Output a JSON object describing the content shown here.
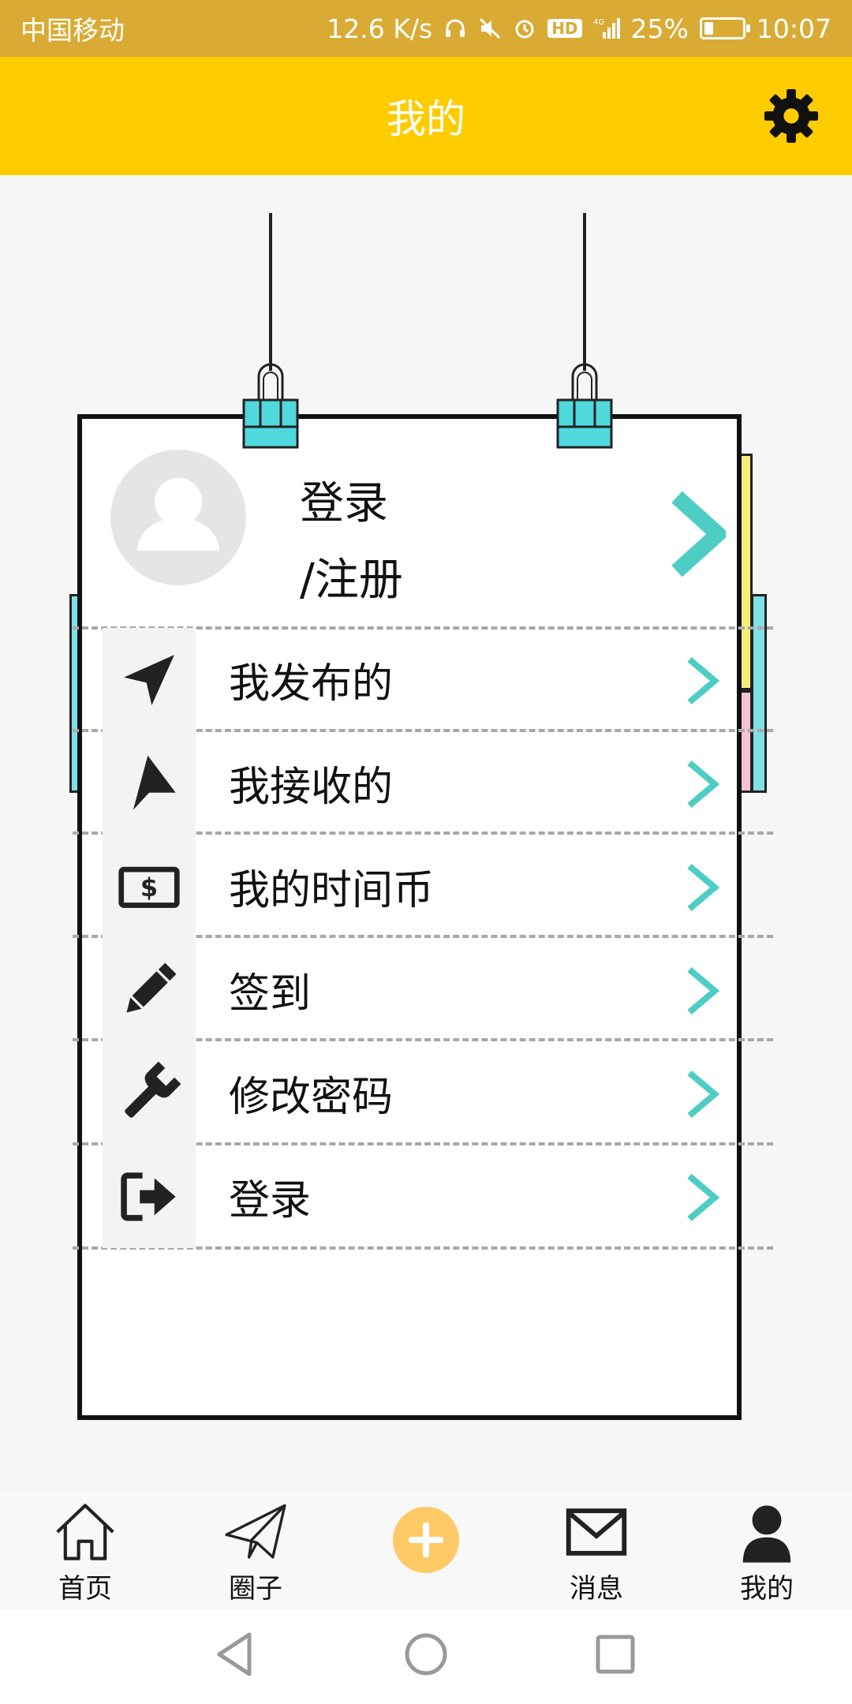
{
  "status_bar": {
    "carrier": "中国移动",
    "speed": "12.6 K/s",
    "hd_badge": "HD",
    "network": "4G",
    "battery_percent": "25%",
    "battery_level": 0.25,
    "time": "10:07",
    "icons": [
      "headphones-icon",
      "mute-icon",
      "alarm-icon",
      "hd-icon",
      "signal-icon",
      "battery-icon"
    ]
  },
  "app_bar": {
    "title": "我的",
    "settings_icon": "gear-icon"
  },
  "profile": {
    "login_line1": "登录",
    "login_line2": "/注册",
    "avatar_icon": "avatar-icon",
    "chevron_icon": "chevron-right-icon"
  },
  "menu": {
    "items": [
      {
        "label": "我发布的",
        "icon": "navigation-arrow-icon"
      },
      {
        "label": "我接收的",
        "icon": "receive-arrow-icon"
      },
      {
        "label": "我的时间币",
        "icon": "money-icon"
      },
      {
        "label": "签到",
        "icon": "pencil-icon"
      },
      {
        "label": "修改密码",
        "icon": "wrench-icon"
      },
      {
        "label": "登录",
        "icon": "sign-out-icon"
      }
    ]
  },
  "bottom_nav": {
    "items": [
      {
        "label": "首页",
        "icon": "home-icon"
      },
      {
        "label": "圈子",
        "icon": "paper-plane-icon"
      },
      {
        "label": "",
        "icon": "plus-icon"
      },
      {
        "label": "消息",
        "icon": "envelope-icon"
      },
      {
        "label": "我的",
        "icon": "user-icon"
      }
    ]
  },
  "colors": {
    "status_bar": "#d9ab34",
    "app_bar": "#ffcc00",
    "accent_teal": "#4ecdc4",
    "plus_button": "#ffc966",
    "tab_yellow": "#f7ec7a",
    "tab_pink": "#f4c4d0",
    "tab_cyan": "#7fe0e6"
  }
}
